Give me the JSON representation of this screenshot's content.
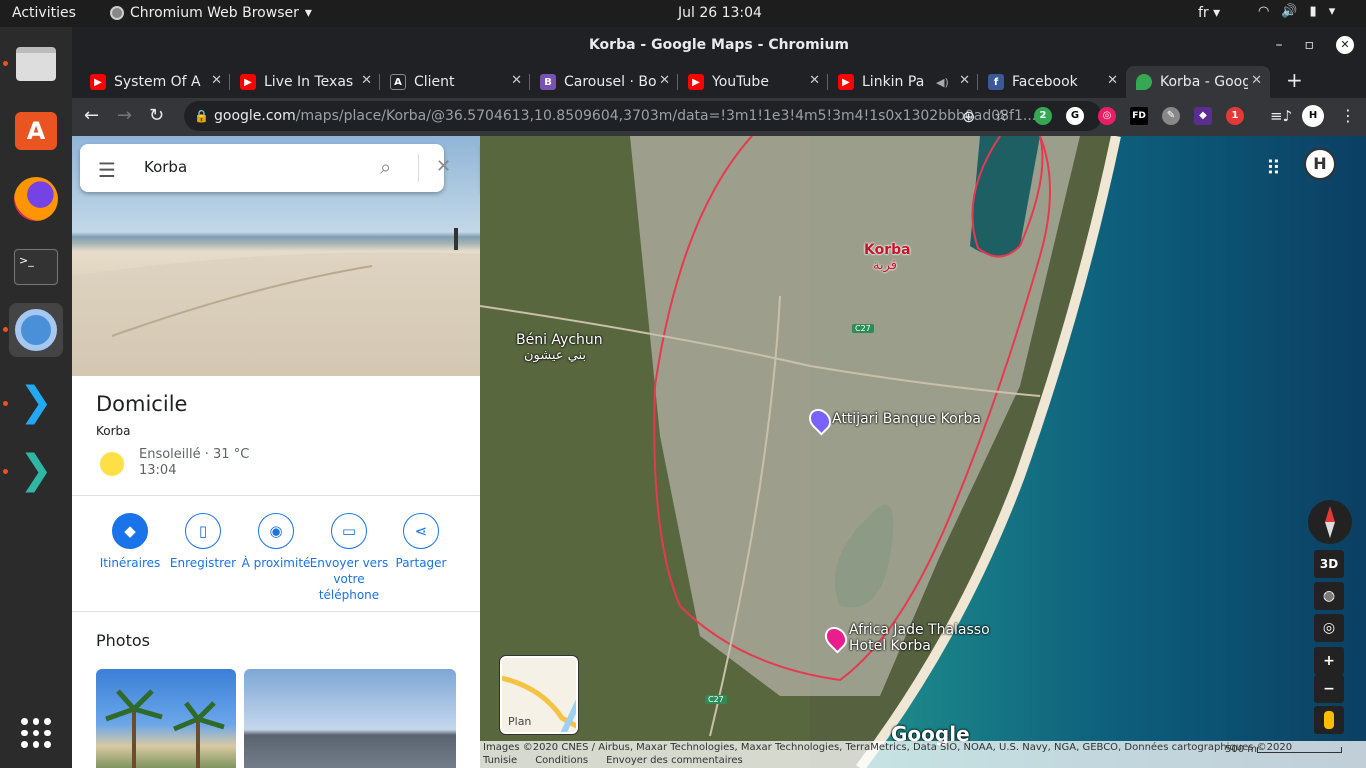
{
  "topbar": {
    "activities": "Activities",
    "app_name": "Chromium Web Browser",
    "clock": "Jul 26  13:04",
    "lang": "fr"
  },
  "window": {
    "title": "Korba - Google Maps - Chromium"
  },
  "tabs": [
    {
      "label": "System Of A",
      "favicon": "youtube-icon",
      "color": "#ff0000"
    },
    {
      "label": "Live In Texas",
      "favicon": "youtube-icon",
      "color": "#ff0000"
    },
    {
      "label": "Client",
      "favicon": "angular-icon",
      "color": "#202124"
    },
    {
      "label": "Carousel · Bo",
      "favicon": "bootstrap-icon",
      "color": "#7952b3"
    },
    {
      "label": "YouTube",
      "favicon": "youtube-icon",
      "color": "#ff0000"
    },
    {
      "label": "Linkin Pa",
      "favicon": "youtube-icon",
      "color": "#ff0000"
    },
    {
      "label": "Facebook",
      "favicon": "facebook-icon",
      "color": "#3b5998"
    },
    {
      "label": "Korba - Goog",
      "favicon": "maps-icon",
      "color": "#34a853"
    }
  ],
  "omnibox": {
    "host": "google.com",
    "path": "/maps/place/Korba/@36.5704613,10.8509604,3703m/data=!3m1!1e3!4m5!3m4!1s0x1302bbb0ad08f1..."
  },
  "extensions": [
    "2",
    "1"
  ],
  "search": {
    "query": "Korba"
  },
  "place": {
    "title": "Domicile",
    "subtitle": "Korba",
    "weather": "Ensoleillé · 31 °C",
    "time": "13:04"
  },
  "actions": [
    {
      "label": "Itinéraires",
      "icon": "directions-icon"
    },
    {
      "label": "Enregistrer",
      "icon": "bookmark-icon"
    },
    {
      "label": "À proximité",
      "icon": "nearby-icon"
    },
    {
      "label": "Envoyer vers votre téléphone",
      "icon": "send-to-phone-icon"
    },
    {
      "label": "Partager",
      "icon": "share-icon"
    }
  ],
  "photos": {
    "title": "Photos"
  },
  "map": {
    "labels": {
      "korba": "Korba",
      "korba_ar": "قربة",
      "beni": "Béni Aychun",
      "beni_ar": "بني عيشون",
      "c27": "C27",
      "bank": "Attijari Banque Korba",
      "hotel_line1": "Africa Jade Thalasso",
      "hotel_line2": "Hotel Korba",
      "google": "Google"
    },
    "plan_label": "Plan",
    "btn_3d": "3D",
    "zoom_in": "+",
    "zoom_out": "−",
    "attribution": "Images ©2020 CNES / Airbus, Maxar Technologies, Maxar Technologies, TerraMetrics, Data SIO, NOAA, U.S. Navy, NGA, GEBCO, Données cartographiques ©2020",
    "footer_links": [
      "Tunisie",
      "Conditions",
      "Envoyer des commentaires"
    ],
    "scale": "500 m"
  }
}
